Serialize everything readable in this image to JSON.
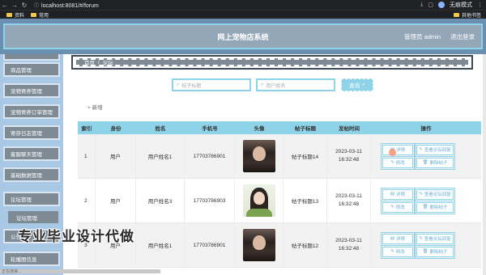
{
  "browser": {
    "url": "localhost:8081/#/forum",
    "bookmarks": [
      "资料",
      "常用"
    ],
    "bookmarks_right": "其他书签",
    "mode_label": "无痕模式"
  },
  "header": {
    "title": "网上宠物店系统",
    "user": "管理员 admin",
    "logout": "退出登录"
  },
  "sidebar": {
    "items": [
      "",
      "商品管理",
      "宠物寄养管理",
      "宠物寄养订单管理",
      "寄存日志管理",
      "客服聊天管理",
      "基础数据管理",
      "论坛管理",
      "公告",
      "轮播图信息"
    ],
    "sub_item": "论坛管理"
  },
  "breadcrumb": {
    "home": "首页",
    "sep": "/",
    "current": "论坛"
  },
  "search": {
    "title_placeholder": "帖子标题",
    "user_placeholder": "用户姓名",
    "button": "查询"
  },
  "toolbar": {
    "add": "新增"
  },
  "table": {
    "headers": [
      "索引",
      "身份",
      "姓名",
      "手机号",
      "头像",
      "帖子标题",
      "发帖时间",
      "操作"
    ],
    "rows": [
      {
        "index": "1",
        "role": "用户",
        "name": "用户姓名1",
        "phone": "17703786901",
        "title": "帖子标题14",
        "time": "2023-03-11 16:32:48"
      },
      {
        "index": "2",
        "role": "用户",
        "name": "用户姓名3",
        "phone": "17703786903",
        "title": "帖子标题13",
        "time": "2023-03-11 16:32:48"
      },
      {
        "index": "3",
        "role": "用户",
        "name": "用户姓名1",
        "phone": "17703786901",
        "title": "帖子标题12",
        "time": "2023-03-11 16:32:48"
      }
    ],
    "actions": {
      "detail": "详情",
      "view_reply": "查看论坛回复",
      "edit": "修改",
      "delete": "删除帖子"
    }
  },
  "watermark": "专业毕业设计代做",
  "status_text": "正在连接...",
  "colors": {
    "accent": "#8fd3e8",
    "sidebar_bg": "#a9c8e6",
    "header_bg": "#94a7b8",
    "item_bg": "#7e8a94"
  }
}
